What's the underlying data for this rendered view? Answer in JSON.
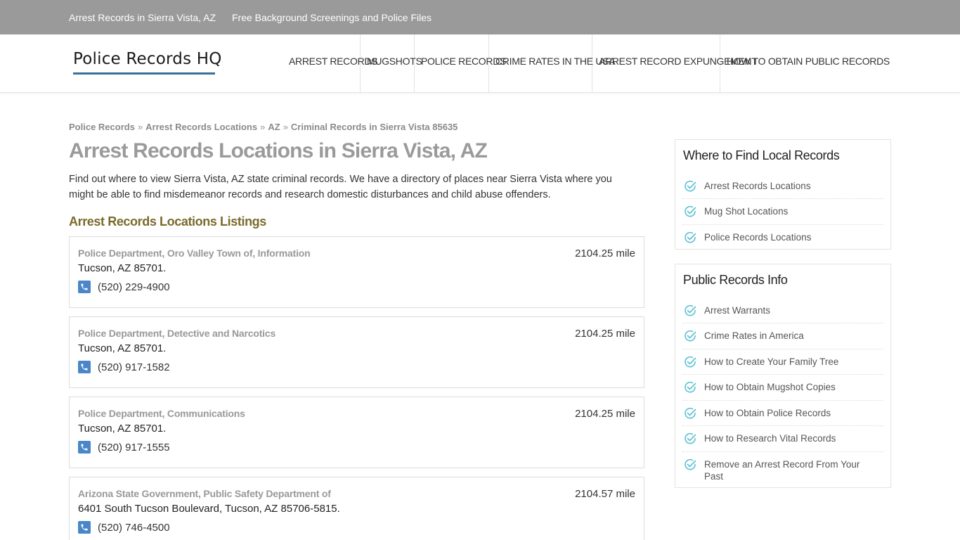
{
  "topbar": {
    "link1": "Arrest Records in Sierra Vista, AZ",
    "link2": "Free Background Screenings and Police Files"
  },
  "logo": {
    "text": "Police Records HQ"
  },
  "nav": [
    {
      "label": "Arrest Records"
    },
    {
      "label": "Mugshots"
    },
    {
      "label": "Police Records"
    },
    {
      "label": "Crime Rates in the USA"
    },
    {
      "label": "Arrest Record Expungement"
    },
    {
      "label": "How to Obtain Public Records"
    }
  ],
  "breadcrumb": {
    "items": [
      "Police Records",
      "Arrest Records Locations",
      "AZ",
      "Criminal Records in Sierra Vista 85635"
    ],
    "separator": "»"
  },
  "main": {
    "title": "Arrest Records Locations in Sierra Vista, AZ",
    "intro": "Find out where to view Sierra Vista, AZ state criminal records. We have a directory of places near Sierra Vista where you might be able to find misdemeanor records and research domestic disturbances and child abuse offenders.",
    "section_title": "Arrest Records Locations Listings",
    "listings": [
      {
        "name": "Police Department, Oro Valley Town of, Information",
        "distance": "2104.25 mile",
        "address": "Tucson, AZ 85701.",
        "phone": "(520) 229-4900"
      },
      {
        "name": "Police Department, Detective and Narcotics",
        "distance": "2104.25 mile",
        "address": "Tucson, AZ 85701.",
        "phone": "(520) 917-1582"
      },
      {
        "name": "Police Department, Communications",
        "distance": "2104.25 mile",
        "address": "Tucson, AZ 85701.",
        "phone": "(520) 917-1555"
      },
      {
        "name": "Arizona State Government, Public Safety Department of",
        "distance": "2104.57 mile",
        "address": "6401 South Tucson Boulevard, Tucson, AZ 85706-5815.",
        "phone": "(520) 746-4500"
      }
    ]
  },
  "sidebar": {
    "local": {
      "title": "Where to Find Local Records",
      "items": [
        "Arrest Records Locations",
        "Mug Shot Locations",
        "Police Records Locations"
      ]
    },
    "info": {
      "title": "Public Records Info",
      "items": [
        "Arrest Warrants",
        "Crime Rates in America",
        "How to Create Your Family Tree",
        "How to Obtain Mugshot Copies",
        "How to Obtain Police Records",
        "How to Research Vital Records",
        "Remove an Arrest Record From Your Past"
      ]
    }
  },
  "colors": {
    "topbar": "#9a9a9a",
    "accent_blue": "#4a86c8",
    "check_teal": "#5bbfd6",
    "section_title": "#7a6a2a"
  }
}
